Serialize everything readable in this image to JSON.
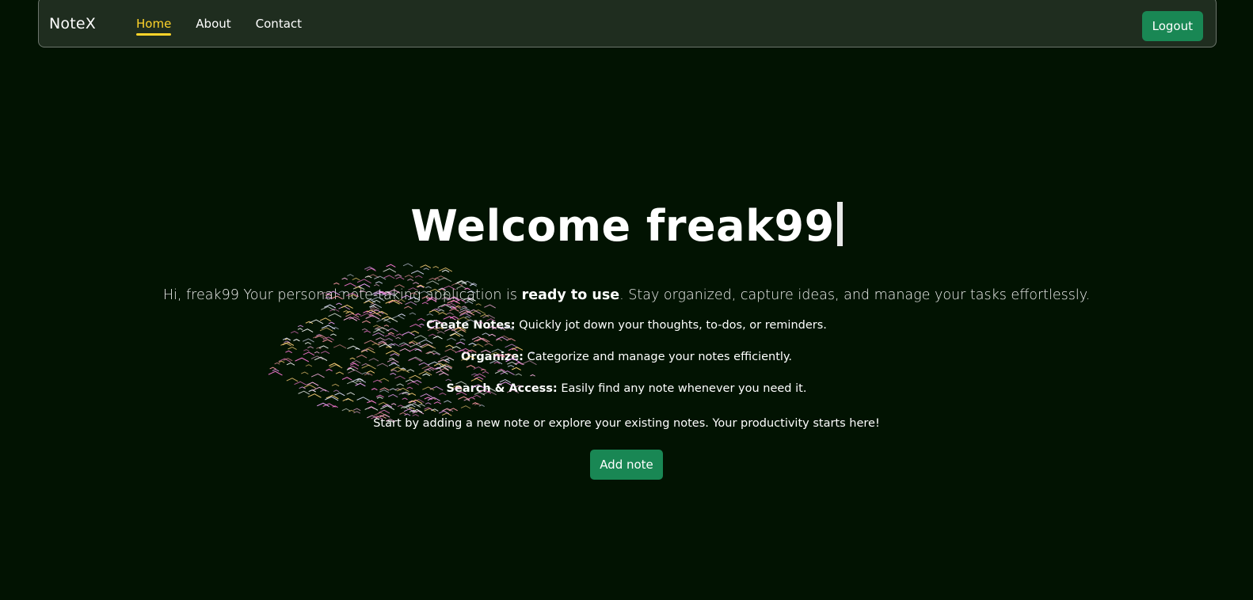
{
  "navbar": {
    "brand": "NoteX",
    "links": [
      {
        "label": "Home",
        "active": true
      },
      {
        "label": "About",
        "active": false
      },
      {
        "label": "Contact",
        "active": false
      }
    ],
    "logout_label": "Logout"
  },
  "hero": {
    "title": "Welcome freak99",
    "lead_prefix": "Hi, freak99 Your personal note-taking application is ",
    "lead_bold": "ready to use",
    "lead_suffix": ". Stay organized, capture ideas, and manage your tasks effortlessly.",
    "features": [
      {
        "title": "Create Notes:",
        "text": " Quickly jot down your thoughts, to-dos, or reminders."
      },
      {
        "title": "Organize:",
        "text": " Categorize and manage your notes efficiently."
      },
      {
        "title": "Search & Access:",
        "text": " Easily find any note whenever you need it."
      }
    ],
    "cta_text": "Start by adding a new note or explore your existing notes. Your productivity starts here!",
    "add_button": "Add note"
  },
  "colors": {
    "background": "#021302",
    "navbar_bg": "#1f2d1f",
    "accent_active": "#ffd42a",
    "button_green": "#198754"
  }
}
